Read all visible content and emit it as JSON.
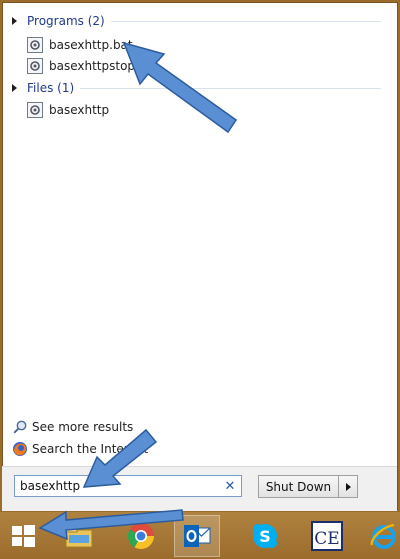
{
  "results": {
    "groups": [
      {
        "label": "Programs (2)",
        "items": [
          "basexhttp.bat",
          "basexhttpstop.bat"
        ]
      },
      {
        "label": "Files (1)",
        "items": [
          "basexhttp"
        ]
      }
    ],
    "see_more": "See more results",
    "search_internet": "Search the Internet"
  },
  "search": {
    "value": "basexhttp",
    "clear": "✕"
  },
  "shutdown": {
    "label": "Shut Down"
  },
  "taskbar": {
    "apps": [
      "start-icon",
      "file-explorer-icon",
      "chrome-icon",
      "outlook-icon",
      "skype-icon",
      "ce-app-icon",
      "internet-explorer-icon"
    ],
    "ce_label": "CE"
  },
  "colors": {
    "accent": "#1e3a8a",
    "arrow": "#5b8fd3",
    "taskbar": "#a87a33"
  }
}
